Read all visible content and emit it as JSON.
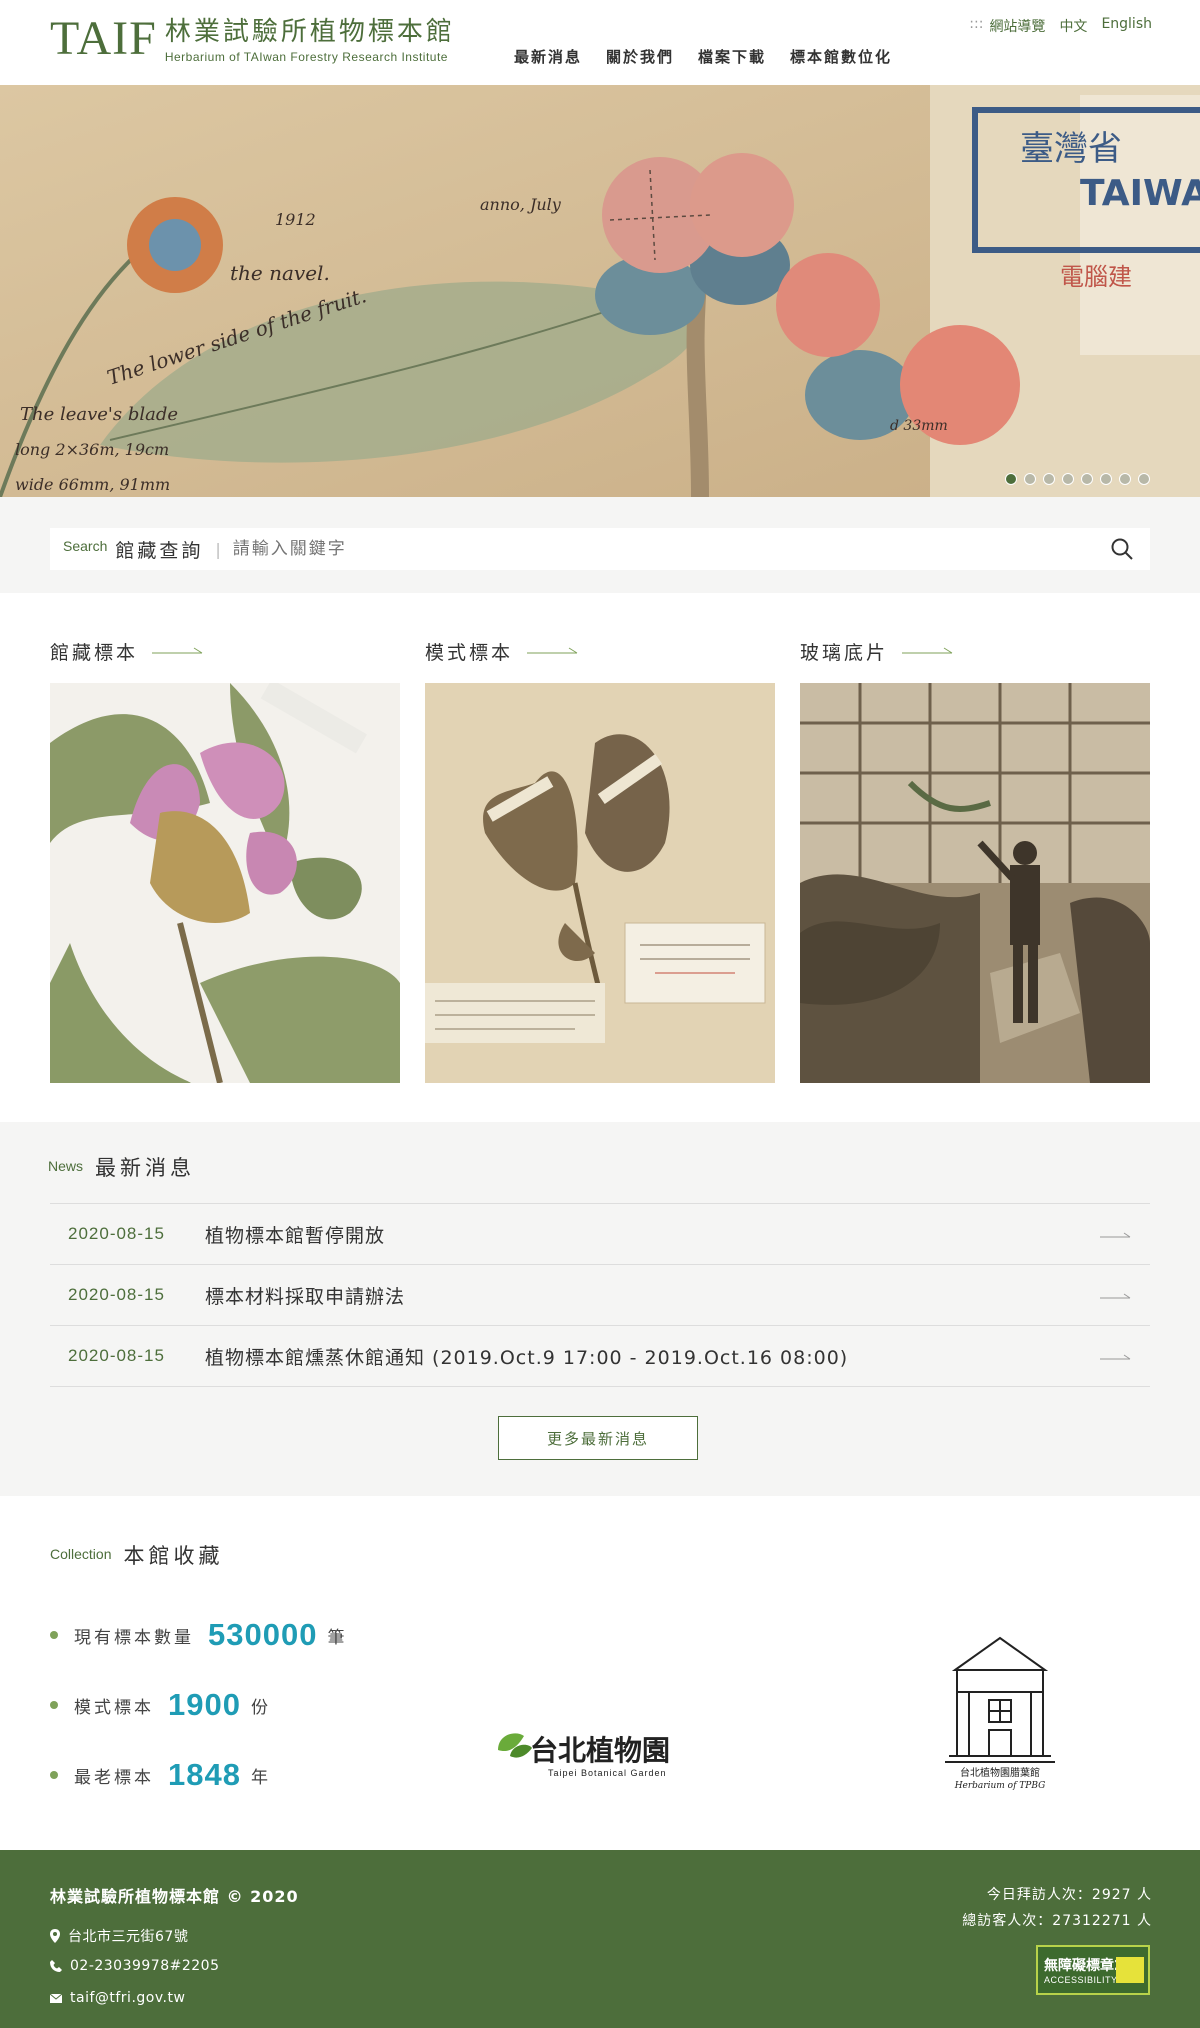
{
  "header": {
    "logo_mark": "TAIF",
    "logo_cn": "林業試驗所植物標本館",
    "logo_en": "Herbarium of TAIwan Forestry Research Institute",
    "top_links": {
      "dots": ":::",
      "sitemap": "網站導覽",
      "lang_zh": "中文",
      "lang_en": "English"
    },
    "nav": [
      "最新消息",
      "關於我們",
      "檔案下載",
      "標本館數位化"
    ]
  },
  "hero": {
    "slides": 8,
    "active_slide": 1
  },
  "search": {
    "label_en": "Search",
    "label_cn": "館藏查詢",
    "separator": "|",
    "placeholder": "請輸入關鍵字"
  },
  "categories": [
    {
      "title": "館藏標本"
    },
    {
      "title": "模式標本"
    },
    {
      "title": "玻璃底片"
    }
  ],
  "news": {
    "label_en": "News",
    "label_cn": "最新消息",
    "items": [
      {
        "date": "2020-08-15",
        "title": "植物標本館暫停開放"
      },
      {
        "date": "2020-08-15",
        "title": "標本材料採取申請辦法"
      },
      {
        "date": "2020-08-15",
        "title": "植物標本館燻蒸休館通知 (2019.Oct.9 17:00 - 2019.Oct.16 08:00)"
      }
    ],
    "more": "更多最新消息"
  },
  "collection": {
    "label_en": "Collection",
    "label_cn": "本館收藏",
    "stats": [
      {
        "label": "現有標本數量",
        "value": "530000",
        "unit": "筆"
      },
      {
        "label": "模式標本",
        "value": "1900",
        "unit": "份"
      },
      {
        "label": "最老標本",
        "value": "1848",
        "unit": "年"
      }
    ],
    "partners": {
      "botanical_garden_cn": "台北植物園",
      "botanical_garden_en": "Taipei Botanical Garden",
      "herbarium_cn": "台北植物園腊葉館",
      "herbarium_en": "Herbarium of TPBG"
    }
  },
  "footer": {
    "name": "林業試驗所植物標本館 © 2020",
    "address": "台北市三元街67號",
    "phone": "02-23039978#2205",
    "email": "taif@tfri.gov.tw",
    "visits_today": "今日拜訪人次：2927 人",
    "visits_total": "總訪客人次：27312271 人",
    "a11y_title": "無障礙標章2.0",
    "a11y_sub": "ACCESSIBILITY"
  },
  "colors": {
    "brand": "#4d6e3b",
    "accent": "#1f9cb5",
    "band": "#f5f5f4"
  }
}
